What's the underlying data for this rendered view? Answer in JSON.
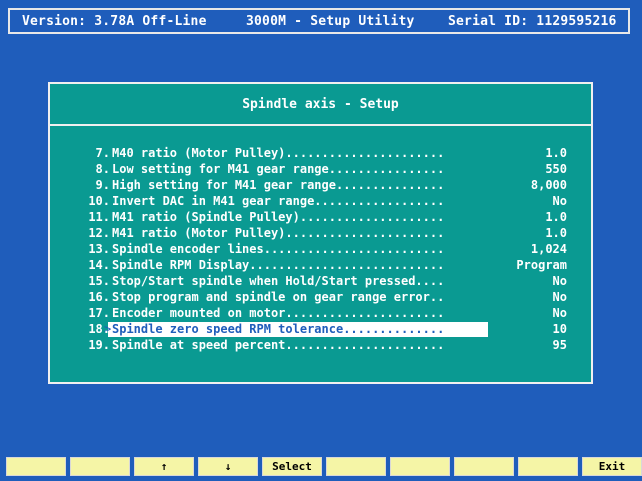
{
  "header": {
    "version": "Version: 3.78A Off-Line",
    "app": "3000M - Setup Utility",
    "serial": "Serial ID: 1129595216"
  },
  "panel": {
    "title": "Spindle axis - Setup",
    "rows": [
      {
        "num": "7.",
        "text": "M40 ratio (Motor Pulley)......................",
        "value": "1.0"
      },
      {
        "num": "8.",
        "text": "Low setting for M41 gear range................",
        "value": "550"
      },
      {
        "num": "9.",
        "text": "High setting for M41 gear range...............",
        "value": "8,000"
      },
      {
        "num": "10.",
        "text": "Invert DAC in M41 gear range..................",
        "value": "No"
      },
      {
        "num": "11.",
        "text": "M41 ratio (Spindle Pulley)....................",
        "value": "1.0"
      },
      {
        "num": "12.",
        "text": "M41 ratio (Motor Pulley)......................",
        "value": "1.0"
      },
      {
        "num": "13.",
        "text": "Spindle encoder lines.........................",
        "value": "1,024"
      },
      {
        "num": "14.",
        "text": "Spindle RPM Display...........................",
        "value": "Program"
      },
      {
        "num": "15.",
        "text": "Stop/Start spindle when Hold/Start pressed....",
        "value": "No"
      },
      {
        "num": "16.",
        "text": "Stop program and spindle on gear range error..",
        "value": "No"
      },
      {
        "num": "17.",
        "text": "Encoder mounted on motor......................",
        "value": "No"
      },
      {
        "num": "18.",
        "text": "Spindle zero speed RPM tolerance..............",
        "value": "10",
        "selected": true
      },
      {
        "num": "19.",
        "text": "Spindle at speed percent......................",
        "value": "95"
      }
    ]
  },
  "fkeys": [
    "",
    "",
    "↑",
    "↓",
    "Select",
    "",
    "",
    "",
    "",
    "Exit"
  ],
  "colors": {
    "background": "#1f5dbb",
    "panel": "#0a9a92",
    "fkey": "#f5f5a6",
    "highlight": "#ffffff"
  }
}
